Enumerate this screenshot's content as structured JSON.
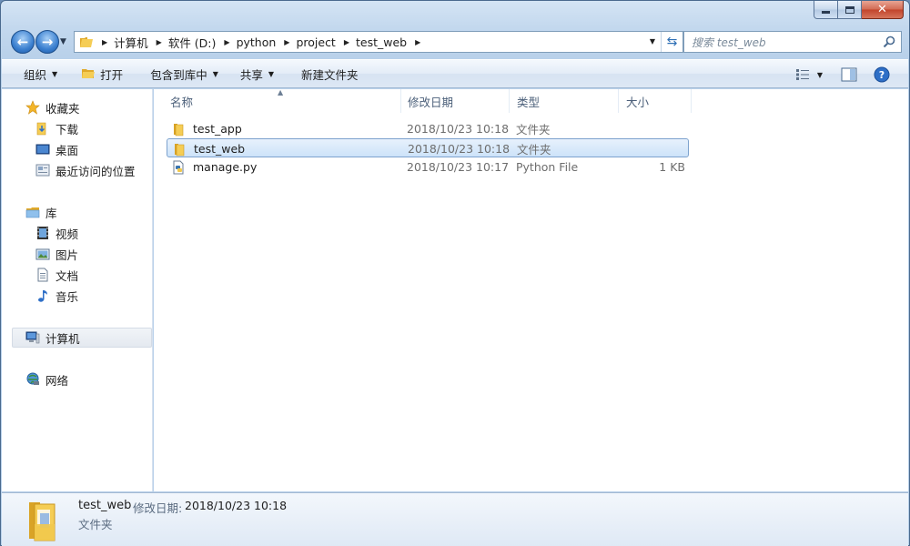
{
  "window": {
    "caption_buttons": [
      "minimize",
      "maximize",
      "close"
    ]
  },
  "address": {
    "breadcrumbs": [
      "计算机",
      "软件 (D:)",
      "python",
      "project",
      "test_web"
    ]
  },
  "search": {
    "placeholder": "搜索 test_web"
  },
  "toolbar": {
    "organize_label": "组织",
    "open_label": "打开",
    "include_library_label": "包含到库中",
    "share_label": "共享",
    "new_folder_label": "新建文件夹"
  },
  "nav": {
    "favorites": "收藏夹",
    "downloads": "下载",
    "desktop": "桌面",
    "recent": "最近访问的位置",
    "libraries": "库",
    "videos": "视频",
    "pictures": "图片",
    "documents": "文档",
    "music": "音乐",
    "computer": "计算机",
    "network": "网络"
  },
  "columns": {
    "name": "名称",
    "modified": "修改日期",
    "type": "类型",
    "size": "大小"
  },
  "files": [
    {
      "name": "test_app",
      "modified": "2018/10/23 10:18",
      "type": "文件夹",
      "size": "",
      "icon": "folder-icon"
    },
    {
      "name": "test_web",
      "modified": "2018/10/23 10:18",
      "type": "文件夹",
      "size": "",
      "icon": "folder-icon",
      "selected": true
    },
    {
      "name": "manage.py",
      "modified": "2018/10/23 10:17",
      "type": "Python File",
      "size": "1 KB",
      "icon": "python-file-icon"
    }
  ],
  "details": {
    "name": "test_web",
    "modified_label": "修改日期:",
    "modified_value": "2018/10/23 10:18",
    "type": "文件夹"
  },
  "colors": {
    "selection_border": "#7da2ce",
    "folder_yellow": "#f2c94c",
    "chrome_blue": "#b9d1ea"
  }
}
